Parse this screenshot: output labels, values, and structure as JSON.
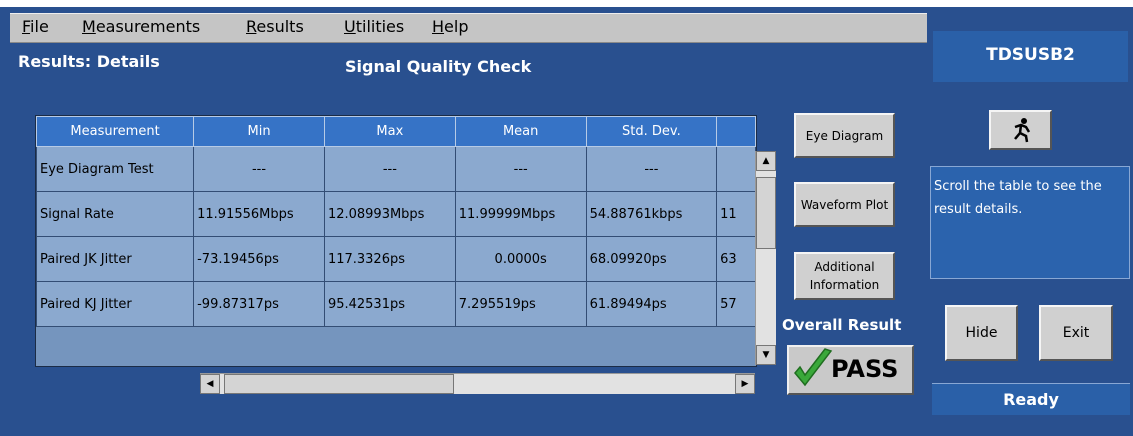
{
  "menu": {
    "items": [
      {
        "label": "File",
        "accel": "F"
      },
      {
        "label": "Measurements",
        "accel": "M"
      },
      {
        "label": "Results",
        "accel": "R"
      },
      {
        "label": "Utilities",
        "accel": "U"
      },
      {
        "label": "Help",
        "accel": "H"
      }
    ]
  },
  "header": {
    "results_label": "Results: Details",
    "section_title": "Signal Quality Check"
  },
  "table": {
    "columns": [
      "Measurement",
      "Min",
      "Max",
      "Mean",
      "Std. Dev.",
      ""
    ],
    "rows": [
      [
        "Eye Diagram Test",
        "---",
        "---",
        "---",
        "---",
        ""
      ],
      [
        "Signal Rate",
        "11.91556Mbps",
        "12.08993Mbps",
        "11.99999Mbps",
        "54.88761kbps",
        "11"
      ],
      [
        "Paired JK Jitter",
        "-73.19456ps",
        "117.3326ps",
        "0.0000s",
        "68.09920ps",
        "63"
      ],
      [
        "Paired KJ Jitter",
        "-99.87317ps",
        "95.42531ps",
        "7.295519ps",
        "61.89494ps",
        "57"
      ]
    ]
  },
  "buttons": {
    "eye_diagram": "Eye Diagram",
    "waveform_plot": "Waveform Plot",
    "additional_information": "Additional Information"
  },
  "overall": {
    "label": "Overall Result",
    "status": "PASS"
  },
  "side": {
    "app_title": "TDSUSB2",
    "info_text": "Scroll the table to see the result details.",
    "hide_label": "Hide",
    "exit_label": "Exit",
    "status": "Ready"
  },
  "colors": {
    "background": "#29508f",
    "table_header": "#3673c6",
    "table_cell": "#8ba9cf",
    "pass_check": "#3aa83a"
  }
}
